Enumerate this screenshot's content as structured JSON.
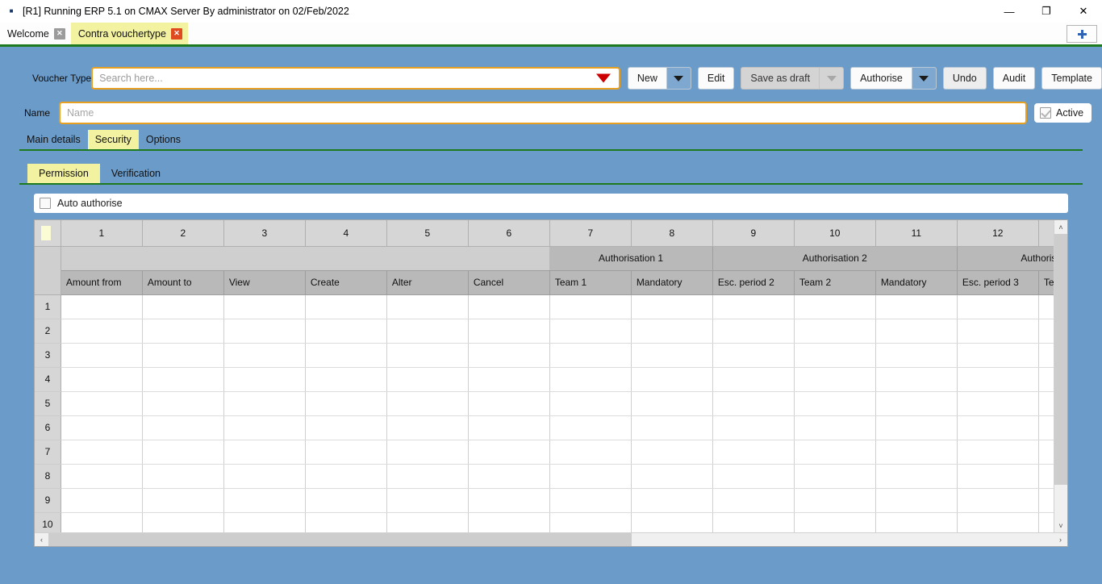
{
  "window": {
    "title": "[R1] Running ERP 5.1 on CMAX Server By administrator on 02/Feb/2022",
    "app_icon": "erp-app-icon",
    "minimize_label": "—",
    "restore_label": "❐",
    "close_label": "✕"
  },
  "tabstrip": {
    "tabs": [
      {
        "label": "Welcome",
        "active": false,
        "close_label": "✕"
      },
      {
        "label": "Contra vouchertype",
        "active": true,
        "close_label": "✕"
      }
    ],
    "new_tab_label": "+"
  },
  "form": {
    "voucher_type_label": "Voucher Type",
    "search_placeholder": "Search here...",
    "search_value": "",
    "name_label": "Name",
    "name_placeholder": "Name",
    "name_value": "",
    "active_label": "Active",
    "active_checked": true
  },
  "toolbar": {
    "buttons": [
      {
        "label": "New",
        "has_dropdown": true,
        "disabled": false
      },
      {
        "label": "Edit",
        "has_dropdown": false,
        "disabled": false
      },
      {
        "label": "Save as draft",
        "has_dropdown": true,
        "disabled": true
      },
      {
        "label": "Authorise",
        "has_dropdown": true,
        "disabled": false
      },
      {
        "label": "Undo",
        "has_dropdown": false,
        "disabled": false
      },
      {
        "label": "Audit",
        "has_dropdown": false,
        "disabled": false
      },
      {
        "label": "Template",
        "has_dropdown": false,
        "disabled": false
      }
    ]
  },
  "tabs_level1": [
    {
      "label": "Main details",
      "active": false
    },
    {
      "label": "Security",
      "active": true
    },
    {
      "label": "Options",
      "active": false
    }
  ],
  "tabs_level2": [
    {
      "label": "Permission",
      "active": true
    },
    {
      "label": "Verification",
      "active": false
    }
  ],
  "auto_authorise": {
    "label": "Auto authorise",
    "checked": false
  },
  "grid": {
    "column_numbers": [
      "1",
      "2",
      "3",
      "4",
      "5",
      "6",
      "7",
      "8",
      "9",
      "10",
      "11",
      "12",
      ""
    ],
    "groups": [
      {
        "label": "",
        "span": 6
      },
      {
        "label": "Authorisation 1",
        "span": 2
      },
      {
        "label": "Authorisation 2",
        "span": 3
      },
      {
        "label": "Authoris",
        "span": 2
      }
    ],
    "fields": [
      "Amount from",
      "Amount to",
      "View",
      "Create",
      "Alter",
      "Cancel",
      "Team 1",
      "Mandatory",
      "Esc. period 2",
      "Team 2",
      "Mandatory",
      "Esc. period 3",
      "Team"
    ],
    "row_numbers": [
      "1",
      "2",
      "3",
      "4",
      "5",
      "6",
      "7",
      "8",
      "9",
      "10"
    ],
    "scroll": {
      "up_arrow": "˄",
      "down_arrow": "˅",
      "left_arrow": "‹",
      "right_arrow": "›"
    }
  },
  "colors": {
    "body_background": "#6b9bc9",
    "tab_active": "#f2f2a0",
    "tab_underline": "#1e7a1e",
    "field_border": "#e8a020",
    "search_caret": "#cc0000",
    "close_tab_active": "#e04a21"
  }
}
